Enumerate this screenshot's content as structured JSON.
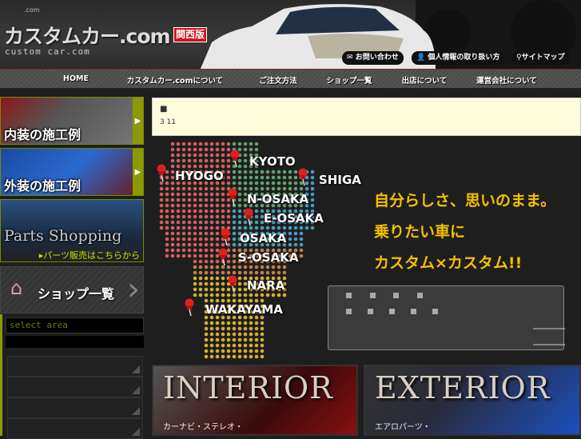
{
  "header": {
    "logo_small": ".com",
    "logo": "カスタムカー.com",
    "logo_sub": "custom car.com",
    "region_badge": "関西版",
    "utility_links": [
      {
        "label": "お問い合わせ",
        "icon": "mail-icon"
      },
      {
        "label": "個人情報の取り扱い方",
        "icon": "person-icon"
      },
      {
        "label": "サイトマップ",
        "icon": "search-icon"
      }
    ]
  },
  "nav": {
    "items": [
      "HOME",
      "カスタムカー.comについて",
      "ご注文方法",
      "ショップ一覧",
      "出店について",
      "運営会社について"
    ]
  },
  "sidebar": {
    "interior": "内装の施工例",
    "exterior": "外装の施工例",
    "parts_title": "Parts Shopping",
    "parts_link": "▸パーツ販売はこちらから",
    "shop_list": "ショップ一覧",
    "select_area": "select area"
  },
  "notice": {
    "mark": "■",
    "text": "3 11"
  },
  "map": {
    "prefectures": [
      "KYOTO",
      "HYOGO",
      "SHIGA",
      "N-OSAKA",
      "E-OSAKA",
      "OSAKA",
      "S-OSAKA",
      "NARA",
      "WAKAYAMA"
    ]
  },
  "slogan": [
    "自分らしさ、思いのまま。",
    "乗りたい車に",
    "カスタム×カスタム!!"
  ],
  "banners": {
    "interior_title": "INTERIOR",
    "interior_sub": "カーナビ・ステレオ・",
    "exterior_title": "EXTERIOR",
    "exterior_sub": "エアロパーツ・"
  },
  "colors": {
    "accent": "#8a9a00",
    "slogan": "#f5c000",
    "notice_bg": "#fffcdc",
    "badge": "#c8151b"
  }
}
